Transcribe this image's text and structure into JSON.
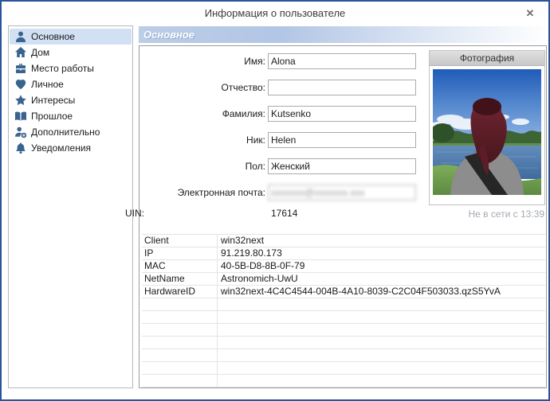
{
  "window": {
    "title": "Информация о пользователе",
    "close_glyph": "✕"
  },
  "sidebar": {
    "items": [
      {
        "key": "basic",
        "label": "Основное",
        "icon": "person-icon",
        "selected": true
      },
      {
        "key": "home",
        "label": "Дом",
        "icon": "home-icon",
        "selected": false
      },
      {
        "key": "work",
        "label": "Место работы",
        "icon": "briefcase-icon",
        "selected": false
      },
      {
        "key": "personal",
        "label": "Личное",
        "icon": "heart-icon",
        "selected": false
      },
      {
        "key": "interests",
        "label": "Интересы",
        "icon": "star-icon",
        "selected": false
      },
      {
        "key": "past",
        "label": "Прошлое",
        "icon": "book-icon",
        "selected": false
      },
      {
        "key": "additional",
        "label": "Дополнительно",
        "icon": "person-plus-icon",
        "selected": false
      },
      {
        "key": "notifications",
        "label": "Уведомления",
        "icon": "bell-icon",
        "selected": false
      }
    ]
  },
  "main": {
    "section_title": "Основное",
    "fields": [
      {
        "key": "first-name",
        "label": "Имя:",
        "value": "Alona",
        "redacted": false
      },
      {
        "key": "middle-name",
        "label": "Отчество:",
        "value": "",
        "redacted": false
      },
      {
        "key": "last-name",
        "label": "Фамилия:",
        "value": "Kutsenko",
        "redacted": false
      },
      {
        "key": "nick",
        "label": "Ник:",
        "value": "Helen",
        "redacted": false
      },
      {
        "key": "gender",
        "label": "Пол:",
        "value": "Женский",
        "redacted": false
      },
      {
        "key": "email",
        "label": "Электронная почта:",
        "value": "",
        "redacted": true,
        "redacted_placeholder": "xxxxxxx@xxxxxxx.xxx"
      }
    ],
    "uin": {
      "label": "UIN:",
      "value": "17614"
    },
    "photo": {
      "header": "Фотография",
      "description": "woman-from-behind-red-hair-lake",
      "status": "Не в сети с 13:39"
    },
    "details_table": {
      "rows": [
        {
          "key": "Client",
          "value": "win32next"
        },
        {
          "key": "IP",
          "value": "91.219.80.173"
        },
        {
          "key": "MAC",
          "value": "40-5B-D8-8B-0F-79"
        },
        {
          "key": "NetName",
          "value": "Astronomich-UwU"
        },
        {
          "key": "HardwareID",
          "value": "win32next-4C4C4544-004B-4A10-8039-C2C04F503033.qzS5YvA"
        }
      ],
      "empty_rows": 7
    }
  },
  "colors": {
    "window_border": "#27549b",
    "icon_blue": "#3a648f",
    "selected_item_bg": "#d2e0f4",
    "header_gradient_left": "#b2c6e5",
    "table_grid": "#e4e4e4",
    "status_gray": "#a4a9b1"
  }
}
